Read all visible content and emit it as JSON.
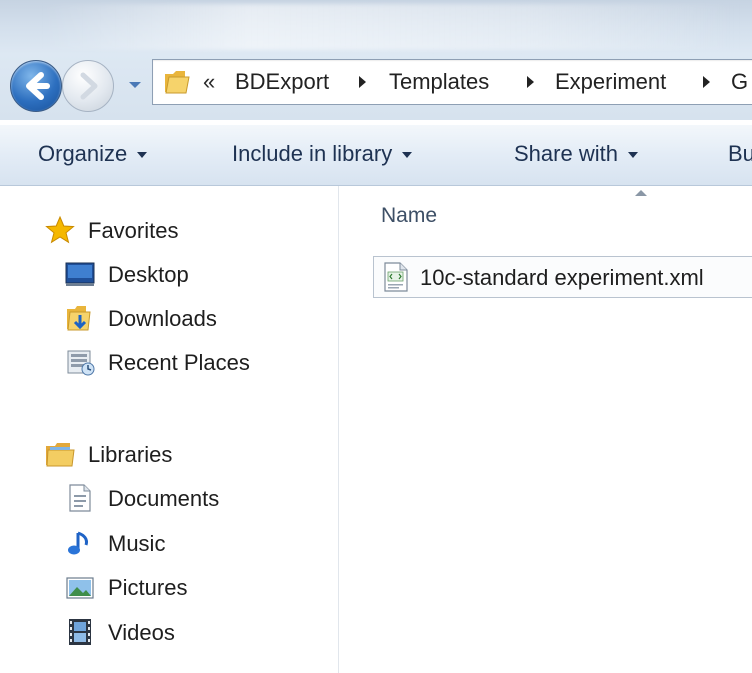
{
  "address_bar": {
    "overflow": "«",
    "breadcrumbs": [
      "BDExport",
      "Templates",
      "Experiment",
      "G"
    ]
  },
  "command_bar": {
    "organize": "Organize",
    "include_in_library": "Include in library",
    "share_with": "Share with",
    "burn": "Bu"
  },
  "navigation": {
    "favorites": {
      "label": "Favorites",
      "icon": "star-icon",
      "items": [
        {
          "label": "Desktop",
          "icon": "desktop-icon"
        },
        {
          "label": "Downloads",
          "icon": "downloads-folder-icon"
        },
        {
          "label": "Recent Places",
          "icon": "recent-places-icon"
        }
      ]
    },
    "libraries": {
      "label": "Libraries",
      "icon": "libraries-folder-icon",
      "items": [
        {
          "label": "Documents",
          "icon": "documents-icon"
        },
        {
          "label": "Music",
          "icon": "music-note-icon"
        },
        {
          "label": "Pictures",
          "icon": "pictures-icon"
        },
        {
          "label": "Videos",
          "icon": "videos-filmstrip-icon"
        }
      ]
    }
  },
  "file_list": {
    "column_header": "Name",
    "files": [
      {
        "name": "10c-standard experiment.xml",
        "icon": "xml-file-icon"
      }
    ]
  },
  "colors": {
    "command_text": "#1e3252",
    "folder_yellow": "#f2c94c",
    "star_yellow": "#f5b800"
  }
}
